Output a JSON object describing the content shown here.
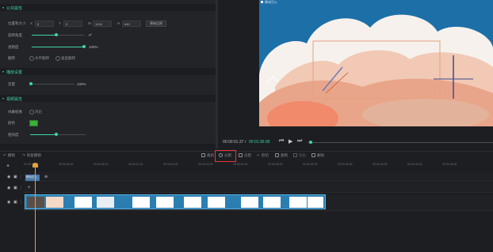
{
  "left_panel": {
    "section_public": "公共属性",
    "position_size_label": "位置和大小",
    "x_label": "X",
    "x_value": "0",
    "y_label": "Y",
    "y_value": "0",
    "w_label": "W",
    "w_value": "1244",
    "h_label": "H",
    "h_value": "640",
    "original_size_button": "原始比例",
    "rotation_label": "旋转角度",
    "rotation_value": "0°",
    "opacity_label": "透明度",
    "opacity_value": "100%",
    "flip_label": "翻转",
    "flip_h": "水平翻转",
    "flip_v": "垂直翻转",
    "section_audio": "播放设置",
    "volume_label": "音量",
    "volume_value": "100%",
    "section_effects": "视频属性",
    "chroma_label": "绿幕抠像",
    "chroma_toggle": "开启",
    "color_label": "颜色",
    "color_swatch": "#3fae3a",
    "intensity_label": "抠除度",
    "accent": "#3fd6a4"
  },
  "preview": {
    "watermark": "移动引入",
    "timecode_current": "00:00:01.37",
    "timecode_total": "00:01:30.00",
    "separator": "/"
  },
  "toolbar": {
    "undo_label": "撤销",
    "redo_label": "恢复撤销",
    "crop_label": "裁剪",
    "split_label": "分割",
    "freeze_label": "冻结",
    "cut_label": "剪切",
    "copy_label": "复制",
    "paste_label": "粘贴",
    "delete_label": "删除"
  },
  "timeline": {
    "ticks": [
      "00:00:00.00",
      "00:00:04.00",
      "00:00:08.00",
      "00:00:12.00",
      "00:00:16.00",
      "00:00:20.00",
      "00:00:24.00",
      "00:00:28.00",
      "00:00:32.00",
      "00:00:36.00",
      "00:00:40.00",
      "00:00:44.00",
      "00:00:48.00",
      "00:00:52.00"
    ],
    "subclip_label": "移动引入"
  }
}
